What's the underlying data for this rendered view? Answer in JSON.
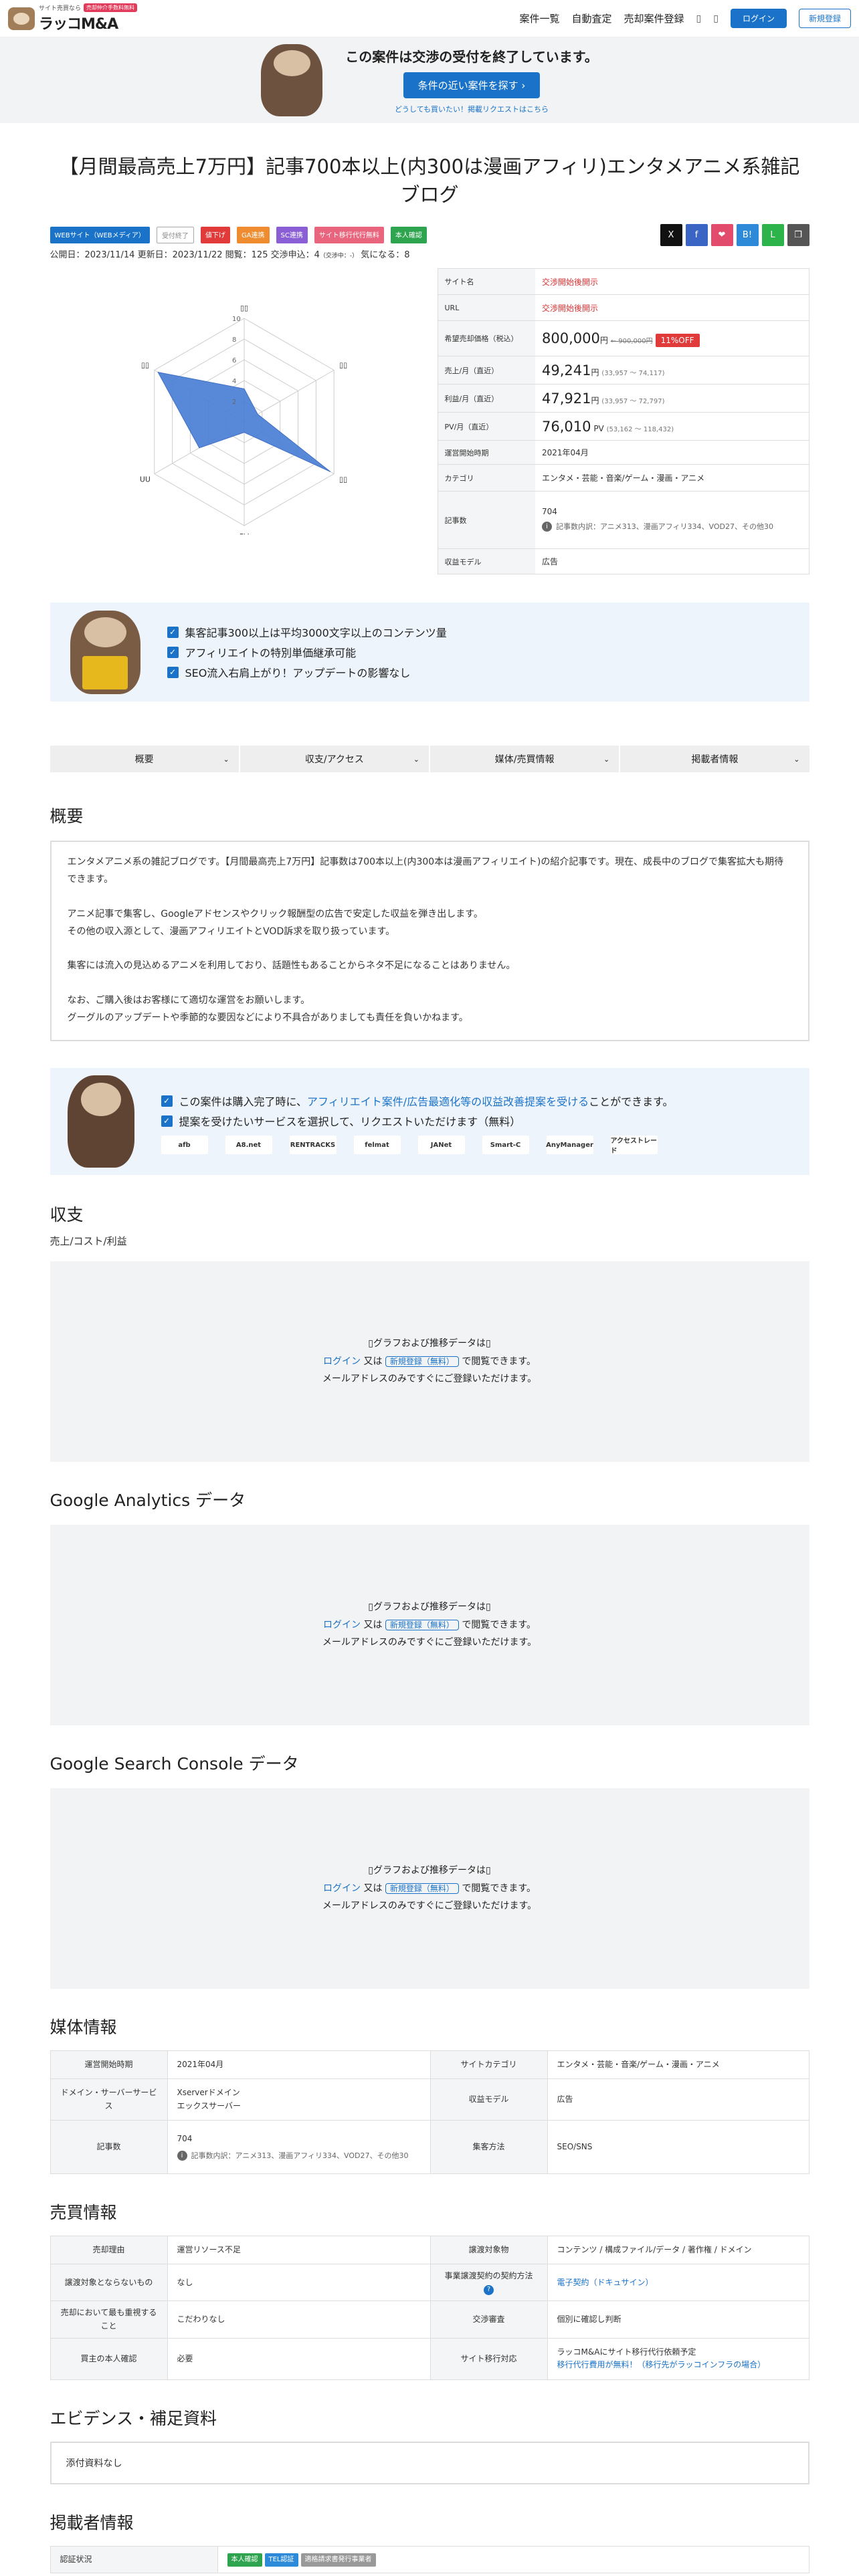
{
  "header": {
    "logo_sub": "サイト売買なら",
    "logo_badge": "売却仲介手数料無料",
    "logo_name": "ラッコM&A",
    "nav": [
      "案件一覧",
      "自動査定",
      "売却案件登録"
    ],
    "login": "ログイン",
    "register": "新規登録"
  },
  "banner": {
    "title": "この案件は交渉の受付を終了しています。",
    "button": "条件の近い案件を探す",
    "link": "どうしても買いたい！掲載リクエストはこちら"
  },
  "title": "【月間最高売上7万円】記事700本以上(内300は漫画アフィリ)エンタメアニメ系雑記ブログ",
  "tags": [
    {
      "label": "WEBサイト（WEBメディア）",
      "color": "#1a73c9"
    },
    {
      "label": "受付終了",
      "color": "outline"
    },
    {
      "label": "値下げ",
      "color": "#e03a3a"
    },
    {
      "label": "GA連携",
      "color": "#f08c30"
    },
    {
      "label": "SC連携",
      "color": "#8a5fd6"
    },
    {
      "label": "サイト移行代行無料",
      "color": "#e8657d"
    },
    {
      "label": "本人確認",
      "color": "#2ea44f"
    }
  ],
  "share": [
    {
      "icon": "x-icon",
      "glyph": "X",
      "color": "#111"
    },
    {
      "icon": "facebook-icon",
      "glyph": "f",
      "color": "#3b65c4"
    },
    {
      "icon": "pocket-icon",
      "glyph": "❤",
      "color": "#e24b6c"
    },
    {
      "icon": "hatena-icon",
      "glyph": "B!",
      "color": "#2c8ad8"
    },
    {
      "icon": "line-icon",
      "glyph": "L",
      "color": "#2cb34a"
    },
    {
      "icon": "copy-icon",
      "glyph": "❐",
      "color": "#555"
    }
  ],
  "meta": {
    "published": "公開日：2023/11/14",
    "updated": "更新日：2023/11/22",
    "views": "閲覧：125",
    "negotiations": "交渉申込：4",
    "negotiations_note": "（交渉中：-）",
    "watch": "気になる：8"
  },
  "radar": {
    "ticks": [
      "10",
      "8",
      "6",
      "4",
      "2"
    ],
    "axes": [
      "▯▯",
      "▯▯",
      "▯▯",
      "PV",
      "UU",
      "▯▯"
    ],
    "values": [
      3.2,
      1.5,
      9.6,
      1.0,
      5.0,
      9.6
    ]
  },
  "info": {
    "site_name_k": "サイト名",
    "site_name": "交渉開始後開示",
    "url_k": "URL",
    "url": "交渉開始後開示",
    "price_k": "希望売却価格（税込）",
    "price": "800,000",
    "price_unit": "円",
    "old_price": "900,000円",
    "off": "11%OFF",
    "sales_k": "売上/月（直近）",
    "sales": "49,241",
    "sales_range": "(33,957 〜 74,117)",
    "profit_k": "利益/月（直近）",
    "profit": "47,921",
    "profit_range": "(33,957 〜 72,797)",
    "pv_k": "PV/月（直近）",
    "pv": "76,010",
    "pv_unit": "PV",
    "pv_range": "(53,162 〜 118,432)",
    "start_k": "運営開始時期",
    "start": "2021年04月",
    "category_k": "カテゴリ",
    "category": "エンタメ・芸能・音楽/ゲーム・漫画・アニメ",
    "articles_k": "記事数",
    "articles": "704",
    "articles_note": "記事数内訳：アニメ313、漫画アフィリ334、VOD27、その他30",
    "revenue_k": "収益モデル",
    "revenue": "広告"
  },
  "promo1": {
    "items": [
      "集客記事300以上は平均3000文字以上のコンテンツ量",
      "アフィリエイトの特別単価継承可能",
      "SEO流入右肩上がり！アップデートの影響なし"
    ]
  },
  "tabs": [
    "概要",
    "収支/アクセス",
    "媒体/売買情報",
    "掲載者情報"
  ],
  "overview": {
    "heading": "概要",
    "lines": [
      "エンタメアニメ系の雑記ブログです。【月間最高売上7万円】記事数は700本以上(内300本は漫画アフィリエイト)の紹介記事です。現在、成長中のブログで集客拡大も期待できます。",
      "",
      "アニメ記事で集客し、Googleアドセンスやクリック報酬型の広告で安定した収益を弾き出します。",
      "その他の収入源として、漫画アフィリエイトとVOD訴求を取り扱っています。",
      "",
      "集客には流入の見込めるアニメを利用しており、話題性もあることからネタ不足になることはありません。",
      "",
      "なお、ご購入後はお客様にて適切な運営をお願いします。",
      "グーグルのアップデートや季節的な要因などにより不具合がありましても責任を負いかねます。"
    ]
  },
  "promo2": {
    "line1_pre": "この案件は購入完了時に、",
    "line1_link": "アフィリエイト案件/広告最適化等の収益改善提案を受ける",
    "line1_post": "ことができます。",
    "line2": "提案を受けたいサービスを選択して、リクエストいただけます（無料）",
    "logos": [
      "afb",
      "A8.net",
      "RENTRACKS",
      "felmat",
      "JANet",
      "Smart-C",
      "AnyManager",
      "アクセストレード"
    ]
  },
  "finance": {
    "heading": "収支",
    "sub": "売上/コスト/利益"
  },
  "ga": {
    "heading": "Google Analytics データ"
  },
  "sc": {
    "heading": "Google Search Console データ"
  },
  "locked": {
    "line1": "▯グラフおよび推移データは▯",
    "login": "ログイン",
    "or": " 又は ",
    "register": "新規登録（無料）",
    "tail": " で閲覧できます。",
    "line3": "メールアドレスのみですぐにご登録いただけます。"
  },
  "media": {
    "heading": "媒体情報",
    "rows": [
      [
        "運営開始時期",
        "2021年04月",
        "サイトカテゴリ",
        "エンタメ・芸能・音楽/ゲーム・漫画・アニメ"
      ],
      [
        "ドメイン・サーバーサービス",
        "Xserverドメイン\nエックスサーバー",
        "収益モデル",
        "広告"
      ],
      [
        "記事数",
        "704",
        "集客方法",
        "SEO/SNS"
      ]
    ],
    "articles_note": "記事数内訳：アニメ313、漫画アフィリ334、VOD27、その他30"
  },
  "trade": {
    "heading": "売買情報",
    "rows": [
      [
        "売却理由",
        "運営リソース不足",
        "譲渡対象物",
        "コンテンツ / 構成ファイル/データ / 著作権 / ドメイン"
      ],
      [
        "譲渡対象とならないもの",
        "なし",
        "事業譲渡契約の契約方法",
        "電子契約（ドキュサイン）"
      ],
      [
        "売却において最も重視すること",
        "こだわりなし",
        "交渉審査",
        "個別に確認し判断"
      ],
      [
        "買主の本人確認",
        "必要",
        "サイト移行対応",
        "ラッコM&Aにサイト移行代行依頼予定"
      ]
    ],
    "migrate_link": "移行代行費用が無料！（移行先がラッコインフラの場合）"
  },
  "evidence": {
    "heading": "エビデンス・補足資料",
    "text": "添付資料なし"
  },
  "seller": {
    "heading": "掲載者情報",
    "verify_k": "認証状況",
    "badges": [
      {
        "label": "本人確認",
        "color": "#2ea44f"
      },
      {
        "label": "TEL認証",
        "color": "#2c8ad8"
      },
      {
        "label": "適格請求書発行事業者",
        "color": "#999"
      }
    ]
  }
}
